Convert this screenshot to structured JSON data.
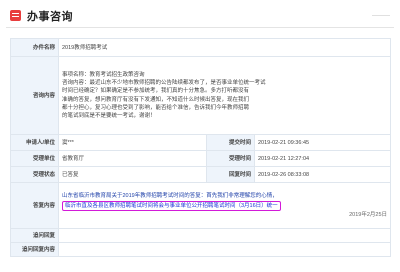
{
  "header": {
    "title": "办事咨询",
    "hint": "———"
  },
  "labels": {
    "title": "办件名称",
    "content": "咨询内容",
    "applicant": "申请人/单位",
    "submit_time": "提交时间",
    "handle_unit": "受理单位",
    "accept_time": "受理时间",
    "status": "受理状态",
    "reply_time": "回复时间",
    "reply": "答复内容",
    "feedback": "追问回复",
    "feedback_content": "追问回复内容"
  },
  "item": {
    "title": "2019教师招聘考试",
    "content_lines": [
      "事项名称：教育考试招生政策咨询",
      "咨询内容：最近山东不少地市教师招聘的公告陆续都发布了，是否事业单位统一考试",
      "时间已经确定？如果确定是不参加统考，我们真的十分焦急。多方打听都没有",
      "准确的答复，想问教育厅有没有下发通知，不知道什么时候出答复，现在我们",
      "都十分担心，复习心理也受到了影响，能否给个准信，告诉我们今年教师招聘",
      "的笔试到底是不是要统一考试，谢谢！"
    ],
    "applicant": "窦***",
    "submit_time": "2019-02-21 09:36:45",
    "handle_unit": "省教育厅",
    "accept_time": "2019-02-21 12:27:04",
    "status": "已答复",
    "reply_time": "2019-02-26 08:33:08",
    "reply_line1": "山东省临沂市教育局关于2019年教师招聘考试时间的答复：首先我们非常理解您的心情，",
    "reply_line2": "在2019年中，临沂市直及各县区教师招聘笔试时间将",
    "reply_highlight": "临沂市直及各县区教师招聘笔试时间将会与事业单位公开招聘笔试时间（3月16日）统一",
    "reply_line3": "2019年2月25日"
  }
}
